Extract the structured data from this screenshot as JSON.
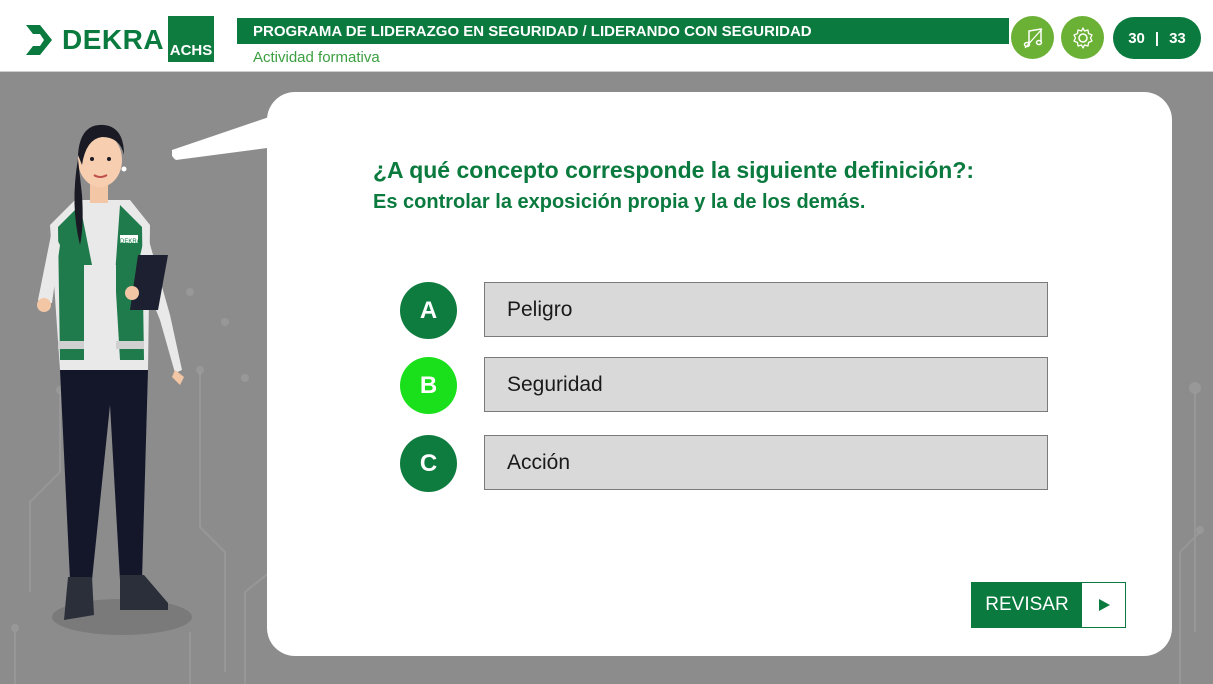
{
  "header": {
    "dekra_logo_text": "DEKRA",
    "achs_logo_text": "ACHS",
    "program_title": "PROGRAMA DE LIDERAZGO EN SEGURIDAD / LIDERANDO CON SEGURIDAD",
    "subtitle": "Actividad formativa",
    "music_icon": "music-note-icon",
    "settings_icon": "gear-icon",
    "page": {
      "current": "30",
      "separator": "|",
      "total": "33"
    }
  },
  "question": {
    "prompt": "¿A qué concepto corresponde la siguiente definición?:",
    "definition": "Es controlar la exposición propia y la de los demás."
  },
  "options": [
    {
      "letter": "A",
      "label": "Peligro",
      "state": "normal"
    },
    {
      "letter": "B",
      "label": "Seguridad",
      "state": "hover"
    },
    {
      "letter": "C",
      "label": "Acción",
      "state": "normal"
    }
  ],
  "actions": {
    "review_label": "REVISAR",
    "review_icon": "play-arrow-icon"
  },
  "colors": {
    "brand_green": "#0a7a3e",
    "light_green": "#6bb135",
    "highlight_green": "#19e01a",
    "background": "#8c8c8c",
    "option_fill": "#d9d9d9"
  }
}
